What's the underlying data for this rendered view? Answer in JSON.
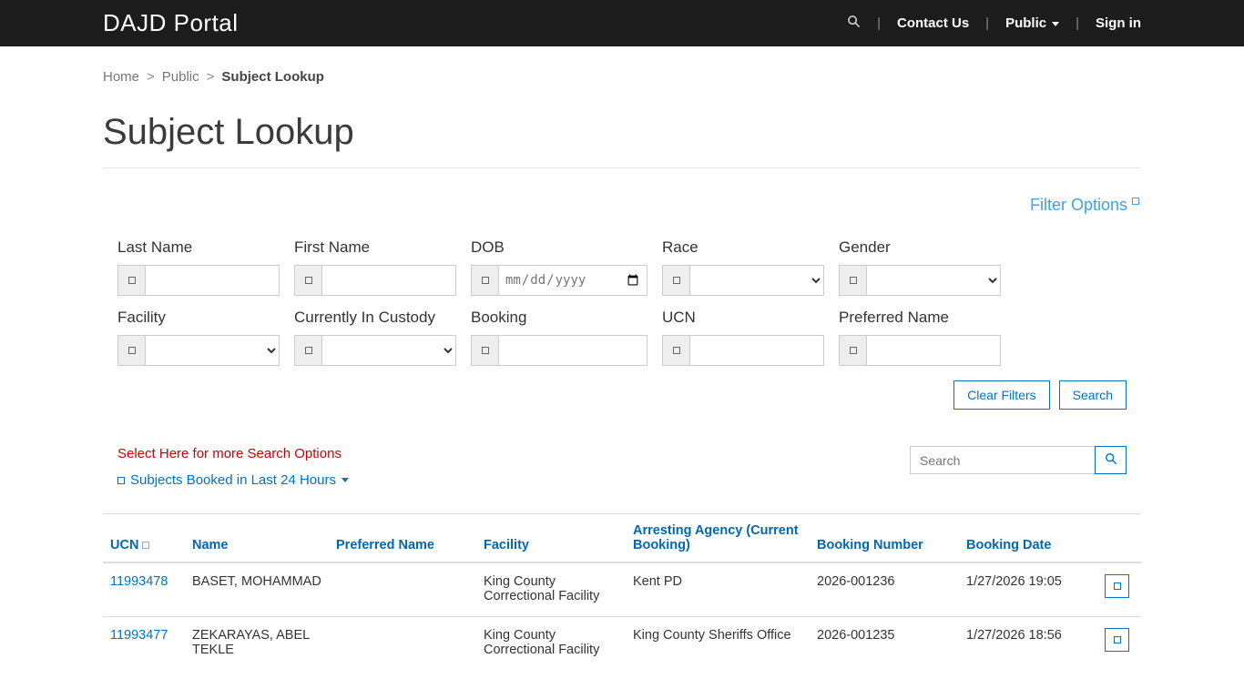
{
  "navbar": {
    "brand": "DAJD Portal",
    "contact_us": "Contact Us",
    "public": "Public",
    "sign_in": "Sign in"
  },
  "breadcrumb": {
    "home": "Home",
    "public": "Public",
    "current": "Subject Lookup",
    "separator": ">"
  },
  "page": {
    "title": "Subject Lookup"
  },
  "filter_panel": {
    "filter_options": "Filter Options",
    "row1": [
      {
        "label": "Last Name",
        "type": "text",
        "value": ""
      },
      {
        "label": "First Name",
        "type": "text",
        "value": ""
      },
      {
        "label": "DOB",
        "type": "date",
        "placeholder": "mm/dd/yyyy",
        "value": ""
      },
      {
        "label": "Race",
        "type": "select",
        "selected": ""
      },
      {
        "label": "Gender",
        "type": "select",
        "selected": ""
      }
    ],
    "row2": [
      {
        "label": "Facility",
        "type": "select",
        "selected": ""
      },
      {
        "label": "Currently In Custody",
        "type": "select",
        "selected": ""
      },
      {
        "label": "Booking",
        "type": "text",
        "value": ""
      },
      {
        "label": "UCN",
        "type": "text",
        "value": ""
      },
      {
        "label": "Preferred Name",
        "type": "text",
        "value": ""
      }
    ],
    "clear_filters_label": "Clear Filters",
    "search_label": "Search"
  },
  "toolbar": {
    "more_options_label": "Select Here for more Search Options",
    "booked_24_label": "Subjects Booked in Last 24 Hours",
    "search_placeholder": "Search"
  },
  "table": {
    "headers": {
      "ucn": "UCN",
      "name": "Name",
      "preferred_name": "Preferred Name",
      "facility": "Facility",
      "arresting_agency": "Arresting Agency (Current Booking)",
      "booking_number": "Booking Number",
      "booking_date": "Booking Date"
    },
    "rows": [
      {
        "ucn": "11993478",
        "name": "BASET, MOHAMMAD",
        "preferred_name": "",
        "facility": "King County Correctional Facility",
        "arresting_agency": "Kent PD",
        "booking_number": "2026-001236",
        "booking_date": "1/27/2026 19:05"
      },
      {
        "ucn": "11993477",
        "name": "ZEKARAYAS, ABEL TEKLE",
        "preferred_name": "",
        "facility": "King County Correctional Facility",
        "arresting_agency": "King County Sheriffs Office",
        "booking_number": "2026-001235",
        "booking_date": "1/27/2026 18:56"
      }
    ]
  },
  "icons": {
    "navbar_search": "magnifier",
    "grid_search": "magnifier",
    "filter_options": "popup-square",
    "ucn_sort": "sort-square",
    "booked_list": "list-square",
    "row_action": "details-square",
    "dropdown_caret": "caret-down"
  },
  "colors": {
    "navbar_bg": "#1c1c1c",
    "link_blue": "#0072c6",
    "table_header_blue": "#0067b8",
    "filter_options_blue": "#3ea2e5",
    "alert_red": "#cc0000"
  }
}
